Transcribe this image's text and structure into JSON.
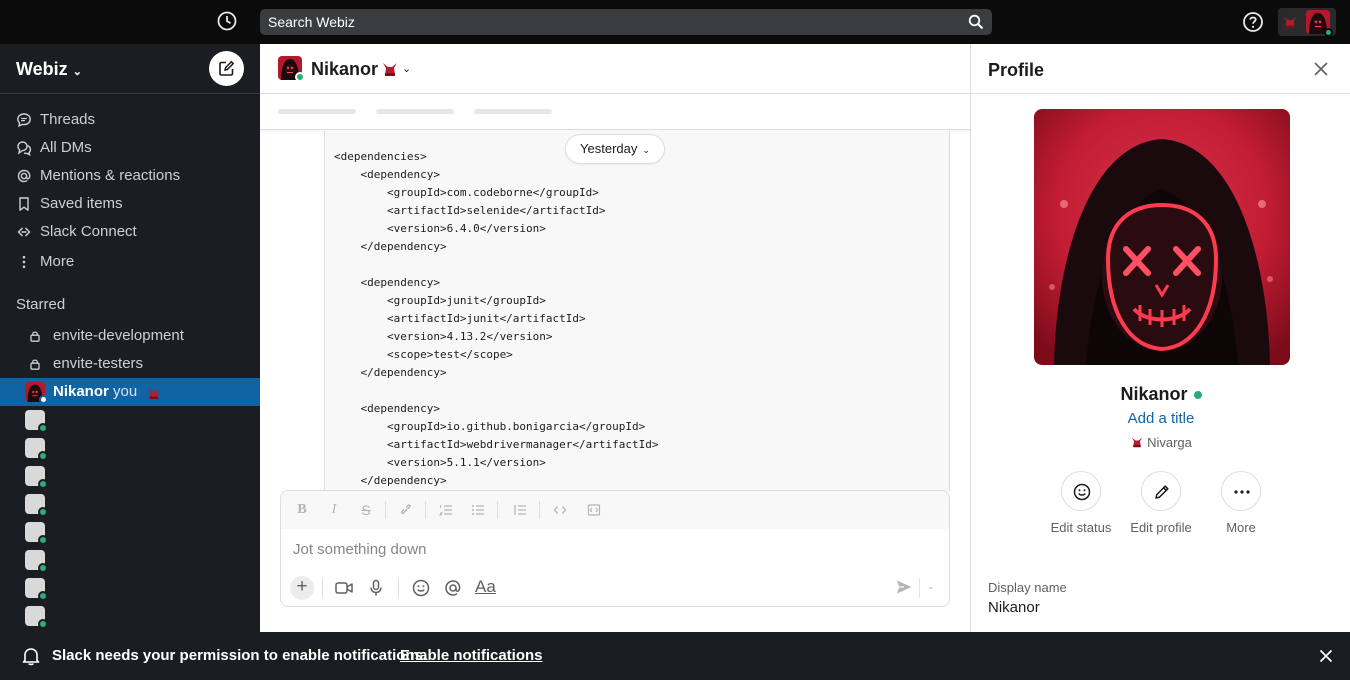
{
  "topbar": {
    "search_placeholder": "Search Webiz"
  },
  "sidebar": {
    "workspace_name": "Webiz",
    "nav": [
      {
        "label": "Threads",
        "icon": "threads-icon"
      },
      {
        "label": "All DMs",
        "icon": "dms-icon"
      },
      {
        "label": "Mentions & reactions",
        "icon": "at-icon"
      },
      {
        "label": "Saved items",
        "icon": "bookmark-icon"
      },
      {
        "label": "Slack Connect",
        "icon": "connect-icon"
      },
      {
        "label": "More",
        "icon": "more-vertical-icon"
      }
    ],
    "starred_title": "Starred",
    "channels": [
      "envite-development",
      "envite-testers"
    ],
    "active_dm": {
      "name": "Nikanor",
      "suffix": "you"
    }
  },
  "channel": {
    "title": "Nikanor",
    "date_divider": "Yesterday",
    "code": "<dependencies>\n    <dependency>\n        <groupId>com.codeborne</groupId>\n        <artifactId>selenide</artifactId>\n        <version>6.4.0</version>\n    </dependency>\n\n    <dependency>\n        <groupId>junit</groupId>\n        <artifactId>junit</artifactId>\n        <version>4.13.2</version>\n        <scope>test</scope>\n    </dependency>\n\n    <dependency>\n        <groupId>io.github.bonigarcia</groupId>\n        <artifactId>webdrivermanager</artifactId>\n        <version>5.1.1</version>\n    </dependency>",
    "composer_placeholder": "Jot something down",
    "format_label": "Aa"
  },
  "profile": {
    "title": "Profile",
    "name": "Nikanor",
    "add_title": "Add a title",
    "org": "Nivarga",
    "actions": [
      "Edit status",
      "Edit profile",
      "More"
    ],
    "display_name_label": "Display name",
    "display_name_value": "Nikanor"
  },
  "notification": {
    "message": "Slack needs your permission to enable notifications.",
    "link": "Enable notifications"
  },
  "colors": {
    "sidebar_bg": "#1a1d21",
    "active_item": "#1164a3",
    "presence": "#2bac76",
    "link": "#1264a3"
  }
}
